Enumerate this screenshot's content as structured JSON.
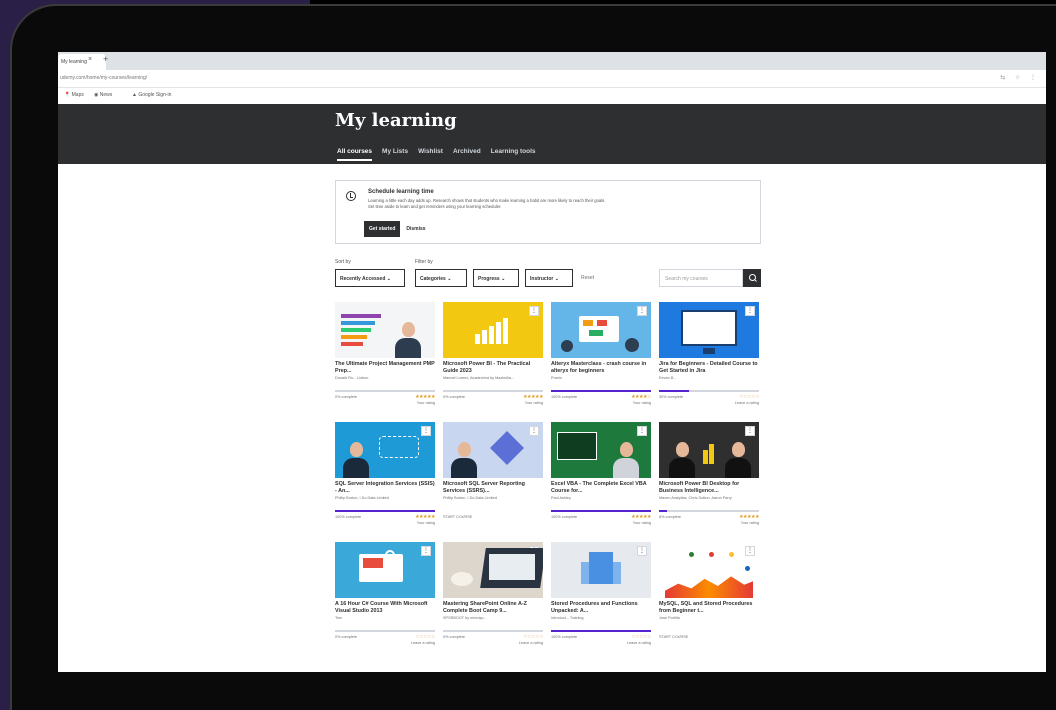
{
  "browser": {
    "tab_title": "My learning",
    "url": "udemy.com/home/my-courses/learning/",
    "bookmarks": [
      "Maps",
      "News",
      "Google Sign-in"
    ]
  },
  "page": {
    "title": "My learning",
    "tabs": [
      "All courses",
      "My Lists",
      "Wishlist",
      "Archived",
      "Learning tools"
    ],
    "active_tab": "All courses"
  },
  "reminder": {
    "title": "Schedule learning time",
    "text_line1": "Learning a little each day adds up. Research shows that students who make learning a habit are more likely to reach their goals.",
    "text_line2": "Set time aside to learn and get reminders using your learning scheduler.",
    "primary_label": "Get started",
    "secondary_label": "Dismiss"
  },
  "filters": {
    "sort_label": "Sort by",
    "filter_label": "Filter by",
    "sort_value": "Recently Accessed",
    "categories": "Categories",
    "progress": "Progress",
    "instructor": "Instructor",
    "reset": "Reset",
    "search_placeholder": "Search my courses"
  },
  "courses": [
    {
      "title": "The Ultimate Project Management PMP Prep...",
      "author": "Donald Ro... Lisbon",
      "progress": 0.0,
      "complete": "0% complete",
      "stars": "★★★★★",
      "rating_text": "Your rating"
    },
    {
      "title": "Microsoft Power BI - The Practical Guide 2023",
      "author": "Manuel Lorenz, Academind by Maximilia...",
      "progress": 0.0,
      "complete": "0% complete",
      "stars": "★★★★★",
      "rating_text": "Your rating"
    },
    {
      "title": "Alteryx Masterclass - crash course in alteryx for beginners",
      "author": "Pranin",
      "progress": 1.0,
      "complete": "100% complete",
      "stars": "★★★★☆",
      "rating_text": "Your rating"
    },
    {
      "title": "Jira for Beginners - Detailed Course to Get Started in Jira",
      "author": "Eevan B...",
      "progress": 0.3,
      "complete": "30% complete",
      "stars": "☆☆☆☆☆",
      "rating_text": "Leave a rating"
    },
    {
      "title": "SQL Server Integration Services (SSIS) - An...",
      "author": "Phillip Burton, I Do Data Limited",
      "progress": 1.0,
      "complete": "100% complete",
      "stars": "★★★★★",
      "rating_text": "Your rating"
    },
    {
      "title": "Microsoft SQL Server Reporting Services (SSRS)...",
      "author": "Phillip Burton, I Do Data Limited",
      "progress": 0.0,
      "complete": "START COURSE",
      "stars": "",
      "rating_text": ""
    },
    {
      "title": "Excel VBA - The Complete Excel VBA Course for...",
      "author": "Paul Ashley",
      "progress": 1.0,
      "complete": "100% complete",
      "stars": "★★★★★",
      "rating_text": "Your rating"
    },
    {
      "title": "Microsoft Power BI Desktop for Business Intelligence...",
      "author": "Maven Analytics, Chris Dutton, Aaron Parry",
      "progress": 0.08,
      "complete": "8% complete",
      "stars": "★★★★★",
      "rating_text": "Your rating"
    },
    {
      "title": "A 16 Hour C# Course With Microsoft Visual Studio 2013",
      "author": "Tom",
      "progress": 0.0,
      "complete": "0% complete",
      "stars": "☆☆☆☆☆",
      "rating_text": "Leave a rating"
    },
    {
      "title": "Mastering SharePoint Online A-Z Complete Boot Camp 9...",
      "author": "SPSRBOOT by microsp...",
      "progress": 0.0,
      "complete": "0% complete",
      "stars": "☆☆☆☆☆",
      "rating_text": "Leave a rating"
    },
    {
      "title": "Stored Procedures and Functions Unpacked: A...",
      "author": "Introduct... Training",
      "progress": 1.0,
      "complete": "100% complete",
      "stars": "☆☆☆☆☆",
      "rating_text": "Leave a rating"
    },
    {
      "title": "MySQL, SQL and Stored Procedures from Beginner t...",
      "author": "Jose Portilla",
      "progress": 0.0,
      "complete": "START COURSE",
      "stars": "",
      "rating_text": ""
    }
  ],
  "colors": {
    "hero_bg": "#2d2f31",
    "accent": "#5624d0",
    "star": "#e59819"
  }
}
